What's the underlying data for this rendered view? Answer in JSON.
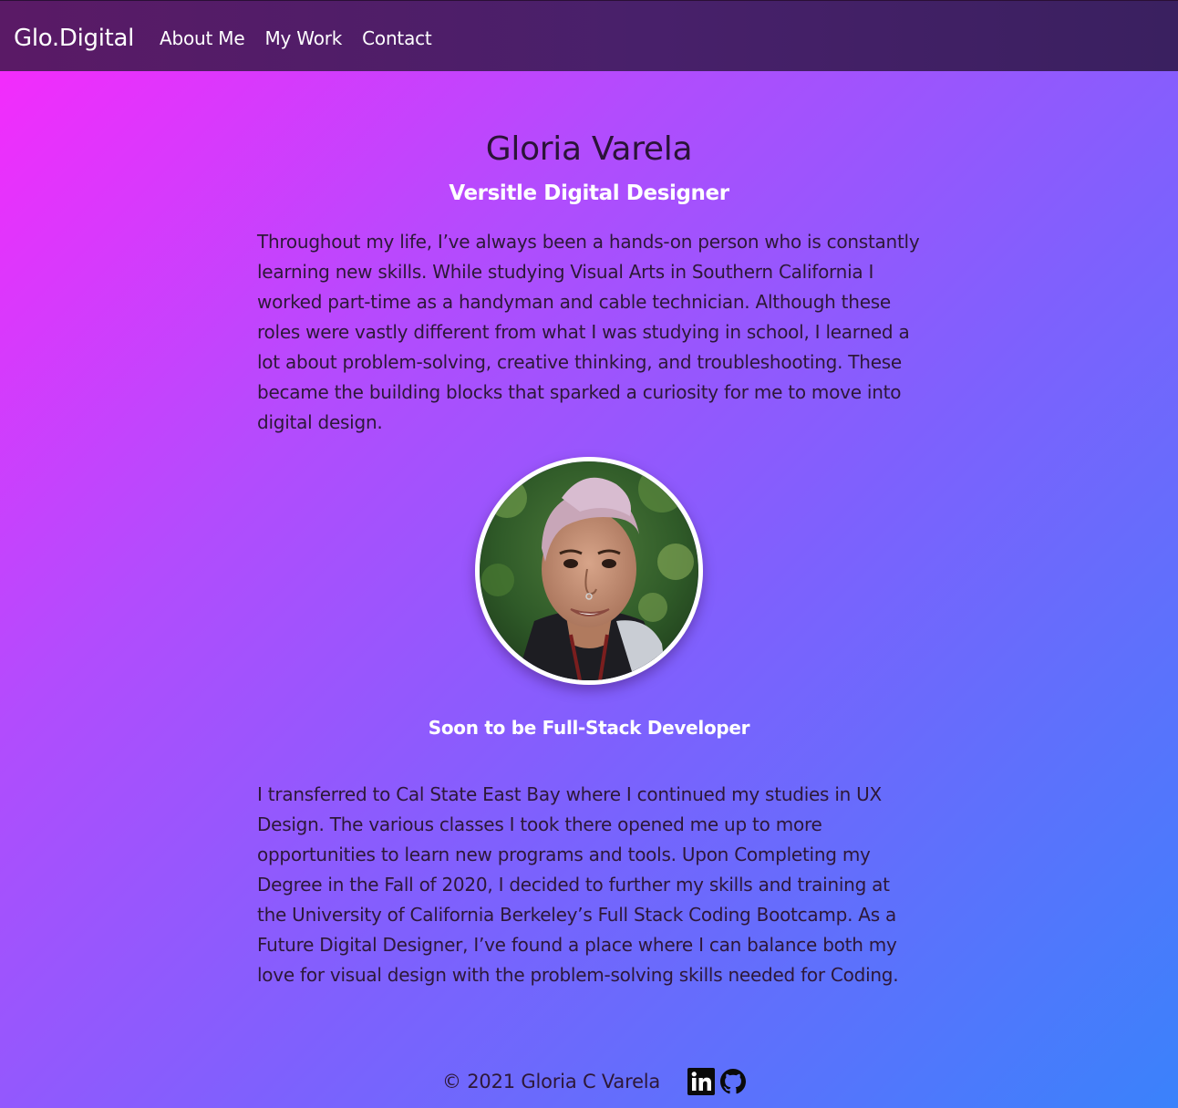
{
  "nav": {
    "brand": "Glo.Digital",
    "links": [
      "About Me",
      "My Work",
      "Contact"
    ]
  },
  "hero": {
    "name": "Gloria Varela",
    "tagline": "Versitle Digital Designer"
  },
  "about": {
    "paragraph1": "Throughout my life, I’ve always been a hands-on person who is constantly learning new skills. While studying Visual Arts in Southern California I worked part-time as a handyman and cable technician. Although these roles were vastly different from what I was studying in school, I learned a lot about problem-solving, creative thinking, and troubleshooting. These became the building blocks that sparked a curiosity for me to move into digital design.",
    "subtitle": "Soon to be Full-Stack Developer",
    "paragraph2": "I transferred to Cal State East Bay where I continued my studies in UX Design. The various classes I took there opened me up to more opportunities to learn new programs and tools. Upon Completing my Degree in the Fall of 2020, I decided to further my skills and training at the University of California Berkeley’s Full Stack Coding Bootcamp. As a Future Digital Designer, I’ve found a place where I can balance both my love for visual design with the problem-solving skills needed for Coding."
  },
  "footer": {
    "copyright": "© 2021 Gloria C Varela",
    "icons": [
      "linkedin-icon",
      "github-icon"
    ]
  },
  "colors": {
    "gradient_start": "#fa28fc",
    "gradient_end": "#3a82fb",
    "navbar": "#4a1d68",
    "heading_text": "#2b1338",
    "accent_text": "#ffffff"
  }
}
